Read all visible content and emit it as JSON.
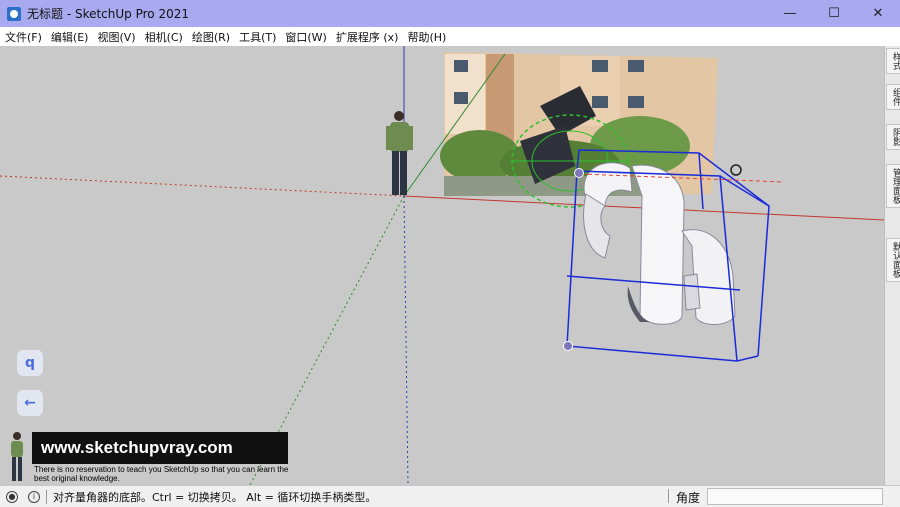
{
  "window": {
    "title": "无标题 - SketchUp Pro 2021",
    "minimize": "—",
    "maximize": "☐",
    "close": "✕"
  },
  "menu": [
    "文件(F)",
    "编辑(E)",
    "视图(V)",
    "相机(C)",
    "绘图(R)",
    "工具(T)",
    "窗口(W)",
    "扩展程序 (x)",
    "帮助(H)"
  ],
  "tray_tabs": [
    "样式",
    "组件",
    "阴影",
    "管理面板",
    "默认面板"
  ],
  "float_buttons": {
    "search_glyph": "q",
    "back_glyph": "←"
  },
  "watermark": {
    "url": "www.sketchupvray.com",
    "tagline": "There is no reservation to teach you SketchUp so that you can learn the best original knowledge."
  },
  "status": {
    "message": "对齐量角器的底部。Ctrl = 切换拷贝。 Alt = 循环切换手柄类型。",
    "measure_label": "角度",
    "measure_value": ""
  },
  "colors": {
    "titlebar": "#a9a9ef",
    "viewport": "#c9c9c9",
    "selection": "#1a2bd8",
    "protractor": "#2cc02c",
    "axis_red": "#c0392b",
    "axis_green": "#2e8b2e",
    "axis_blue": "#2d3bb0"
  }
}
